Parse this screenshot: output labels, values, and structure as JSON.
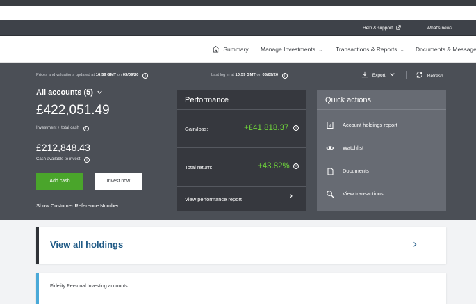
{
  "utility": {
    "help_label": "Help & support",
    "whats_new_label": "What's new?"
  },
  "nav": {
    "summary": "Summary",
    "manage_investments": "Manage Investments",
    "transactions_reports": "Transactions & Reports",
    "documents_messages": "Documents & Messages"
  },
  "info": {
    "prices_prefix": "Prices and valuations updated at",
    "prices_time": "16:59 GMT",
    "prices_on": "on",
    "prices_date": "03/09/20",
    "login_prefix": "Last log in at",
    "login_time": "10:59 GMT",
    "login_on": "on",
    "login_date": "03/09/20"
  },
  "toolbar": {
    "export_label": "Export",
    "refresh_label": "Refresh"
  },
  "accounts": {
    "title": "All accounts (5)",
    "total_value": "£422,051.49",
    "total_caption": "Investment + total cash",
    "cash_value": "£212,848.43",
    "cash_caption": "Cash available to invest",
    "add_cash_label": "Add cash",
    "invest_now_label": "Invest now",
    "show_ref_label": "Show Customer Reference Number"
  },
  "performance": {
    "heading": "Performance",
    "gain_label": "Gain/loss:",
    "gain_value": "+£41,818.37",
    "return_label": "Total return:",
    "return_value": "+43.82%",
    "report_label": "View performance report"
  },
  "quick_actions": {
    "heading": "Quick actions",
    "items": [
      {
        "label": "Account holdings report",
        "icon": "report-icon"
      },
      {
        "label": "Watchlist",
        "icon": "eye-icon"
      },
      {
        "label": "Documents",
        "icon": "documents-icon"
      },
      {
        "label": "View transactions",
        "icon": "search-icon"
      }
    ]
  },
  "holdings": {
    "title": "View all holdings"
  },
  "account_card": {
    "title": "Fidelity Personal Investing accounts"
  },
  "colors": {
    "dark_bar": "#3e4249",
    "dashboard_bg": "#4b4f56",
    "performance_bg": "#36383e",
    "quick_actions_bg": "#676b73",
    "accent_green": "#4aa52b",
    "gain_green": "#6fd43b",
    "link_blue": "#1f5a86",
    "card_accent_blue": "#4aa9d8"
  }
}
